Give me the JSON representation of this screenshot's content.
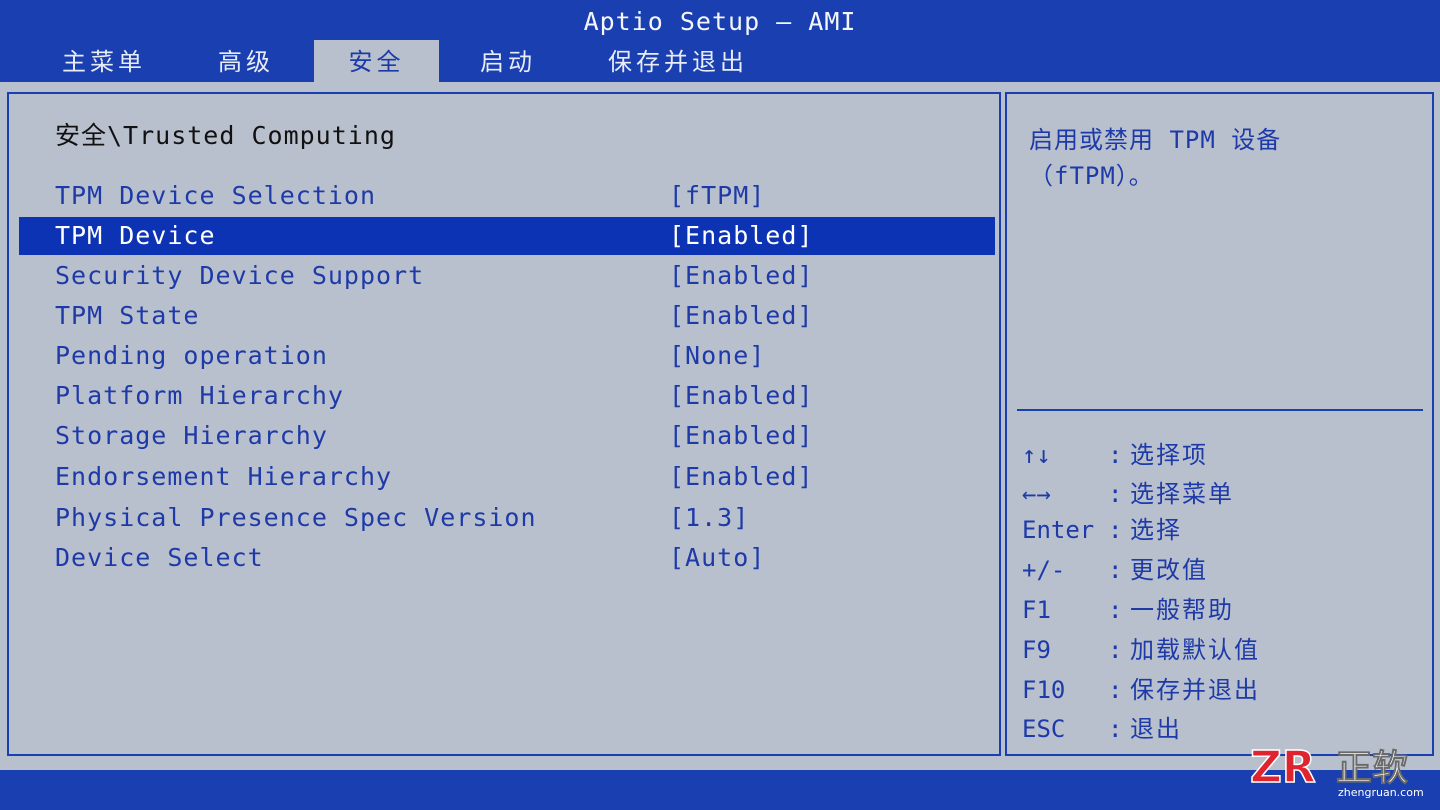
{
  "title": "Aptio Setup – AMI",
  "tabs": [
    {
      "label": "主菜单",
      "active": false
    },
    {
      "label": "高级",
      "active": false
    },
    {
      "label": "安全",
      "active": true
    },
    {
      "label": "启动",
      "active": false
    },
    {
      "label": "保存并退出",
      "active": false
    }
  ],
  "breadcrumb": "安全\\Trusted Computing",
  "settings": [
    {
      "label": "TPM Device Selection",
      "value": "[fTPM]"
    },
    {
      "label": "TPM Device",
      "value": "[Enabled]",
      "selected": true
    },
    {
      "label": "Security Device Support",
      "value": "[Enabled]"
    },
    {
      "label": "TPM State",
      "value": "[Enabled]"
    },
    {
      "label": "Pending operation",
      "value": "[None]"
    },
    {
      "label": "Platform Hierarchy",
      "value": "[Enabled]"
    },
    {
      "label": "Storage Hierarchy",
      "value": "[Enabled]"
    },
    {
      "label": "Endorsement Hierarchy",
      "value": "[Enabled]"
    },
    {
      "label": "Physical Presence Spec Version",
      "value": "[1.3]"
    },
    {
      "label": "Device Select",
      "value": "[Auto]"
    }
  ],
  "help": {
    "line1": "启用或禁用 TPM 设备",
    "line2": "（fTPM）。"
  },
  "keys": [
    {
      "key": "↑↓",
      "sep": ":",
      "desc": "选择项"
    },
    {
      "key": "←→",
      "sep": ":",
      "desc": "选择菜单"
    },
    {
      "key": "Enter",
      "sep": ":",
      "desc": "选择"
    },
    {
      "key": "+/-",
      "sep": ":",
      "desc": "更改值"
    },
    {
      "key": "F1",
      "sep": ":",
      "desc": "一般帮助"
    },
    {
      "key": "F9",
      "sep": ":",
      "desc": "加载默认值"
    },
    {
      "key": "F10",
      "sep": ":",
      "desc": "保存并退出"
    },
    {
      "key": "ESC",
      "sep": ":",
      "desc": "退出"
    }
  ],
  "watermark": {
    "logo": "ZR",
    "brand": "正软",
    "domain": "zhengruan.com"
  },
  "colors": {
    "bios_blue": "#1a3fb0",
    "panel_gray": "#b9c0cd",
    "selection": "#0d33b5",
    "accent_red": "#e0242f"
  }
}
